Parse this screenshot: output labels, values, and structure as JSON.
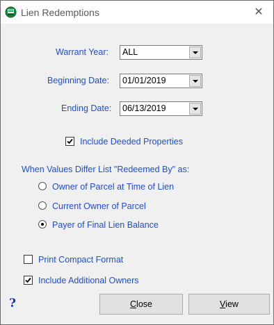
{
  "window": {
    "title": "Lien Redemptions",
    "close_glyph": "✕"
  },
  "form": {
    "warrant_year": {
      "label": "Warrant Year:",
      "value": "ALL"
    },
    "beginning_date": {
      "label": "Beginning Date:",
      "value": "01/01/2019"
    },
    "ending_date": {
      "label": "Ending Date:",
      "value": "06/13/2019"
    },
    "include_deeded": {
      "label": "Include Deeded Properties",
      "checked": true
    },
    "redeemed_by": {
      "heading": "When Values Differ List \"Redeemed By\" as:",
      "options": [
        {
          "label": "Owner of Parcel at Time of Lien",
          "selected": false
        },
        {
          "label": "Current Owner of Parcel",
          "selected": false
        },
        {
          "label": "Payer of Final Lien Balance",
          "selected": true
        }
      ]
    },
    "print_compact": {
      "label": "Print Compact Format",
      "checked": false
    },
    "include_additional_owners": {
      "label": "Include Additional Owners",
      "checked": true
    }
  },
  "buttons": {
    "help": "?",
    "close_first": "C",
    "close_rest": "lose",
    "view_first": "V",
    "view_rest": "iew"
  },
  "icons": {
    "app": "app-icon",
    "close": "close-icon",
    "dropdown": "chevron-down-icon",
    "checkmark": "checkmark-icon",
    "help": "help-icon"
  }
}
